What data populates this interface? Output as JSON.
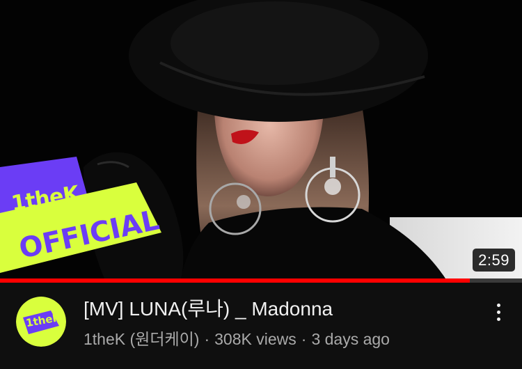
{
  "video": {
    "title": "[MV] LUNA(루나) _ Madonna",
    "channel": "1theK (원더케이)",
    "views": "308K views",
    "age": "3 days ago",
    "separator": "·",
    "duration": "2:59",
    "watched_fraction": 0.9
  },
  "thumbnail": {
    "logo_text": "1theK",
    "badge_text": "OFFICIAL"
  },
  "avatar": {
    "logo_text": "1theK"
  },
  "icons": {
    "more": "more-vert-icon"
  },
  "colors": {
    "progress": "#ff0000",
    "badge_lime": "#d9ff3d",
    "brand_purple": "#6b3df5"
  }
}
